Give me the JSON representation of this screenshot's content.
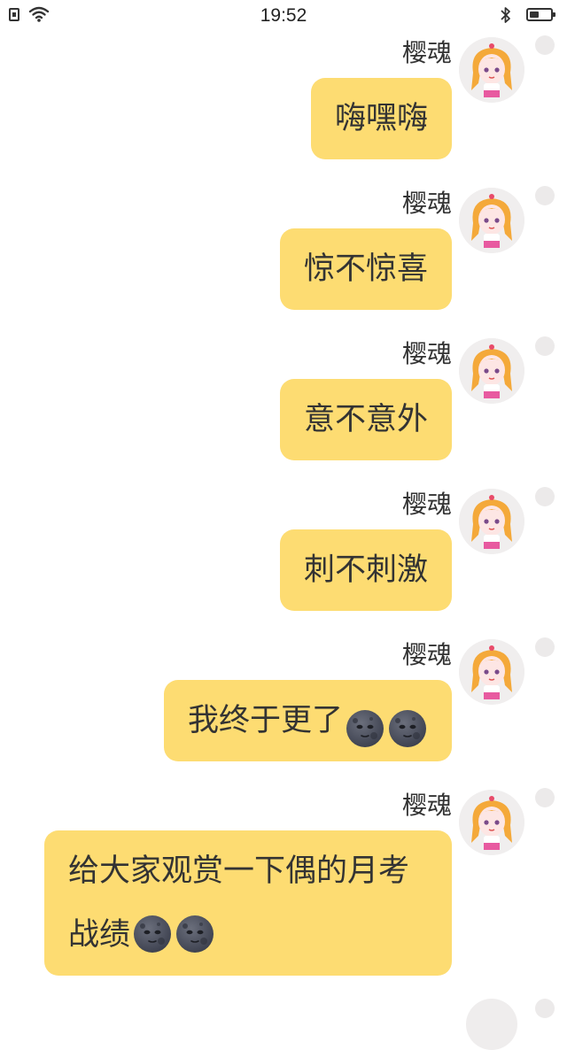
{
  "status_bar": {
    "time": "19:52",
    "battery_level": 0.45,
    "icons": [
      "sim-icon",
      "wifi-icon",
      "bluetooth-icon",
      "battery-icon"
    ]
  },
  "colors": {
    "bubble": "#fddc72",
    "text": "#333333",
    "select_circle": "#eceaea",
    "emoji_moon": "#3b3f4d"
  },
  "messages": [
    {
      "sender": "樱魂",
      "text": "嗨嘿嗨"
    },
    {
      "sender": "樱魂",
      "text": "惊不惊喜"
    },
    {
      "sender": "樱魂",
      "text": "意不意外"
    },
    {
      "sender": "樱魂",
      "text": "刺不刺激"
    },
    {
      "sender": "樱魂",
      "text": "我终于更了",
      "emoji": [
        "new-moon-face-emoji",
        "new-moon-face-emoji"
      ]
    },
    {
      "sender": "樱魂",
      "text": "给大家观赏一下偶的月考战绩",
      "emoji": [
        "new-moon-face-emoji",
        "new-moon-face-emoji"
      ]
    }
  ]
}
